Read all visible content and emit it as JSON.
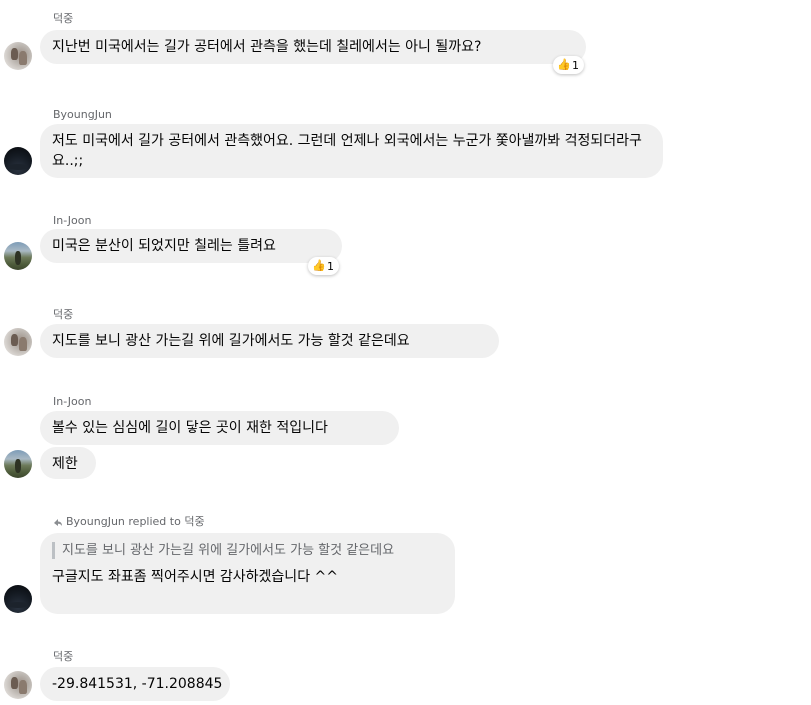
{
  "messages": [
    {
      "sender": "덕중",
      "bubbles": [
        "지난번 미국에서는 길가 공터에서 관측을 했는데 칠레에서는 아니 될까요?"
      ],
      "reaction": {
        "icon": "thumbs-up-icon",
        "emoji": "👍",
        "count": "1"
      }
    },
    {
      "sender": "ByoungJun",
      "bubbles": [
        "저도 미국에서 길가 공터에서 관측했어요. 그런데 언제나 외국에서는 누군가 쫓아낼까봐 걱정되더라구요..;;"
      ]
    },
    {
      "sender": "In-Joon",
      "bubbles": [
        "미국은 분산이 되었지만  칠레는 틀려요"
      ],
      "reaction": {
        "icon": "thumbs-up-icon",
        "emoji": "👍",
        "count": "1"
      }
    },
    {
      "sender": "덕중",
      "bubbles": [
        "지도를 보니 광산 가는길 위에 길가에서도 가능 할것 같은데요"
      ]
    },
    {
      "sender": "In-Joon",
      "bubbles": [
        "볼수 있는 심심에 길이 닿은 곳이 재한 적입니다",
        "제한"
      ]
    },
    {
      "reply_header": "ByoungJun replied to 덕중",
      "quote": "지도를 보니 광산 가는길 위에 길가에서도 가능 할것 같은데요",
      "bubbles": [
        "구글지도 좌표좀 찍어주시면 감사하겠습니다 ^^"
      ]
    },
    {
      "sender": "덕중",
      "bubbles": [
        "-29.841531, -71.208845"
      ]
    }
  ],
  "colors": {
    "bubble_bg": "#f0f0f0",
    "name_text": "#65676b",
    "message_text": "#050505",
    "page_bg": "#ffffff"
  }
}
